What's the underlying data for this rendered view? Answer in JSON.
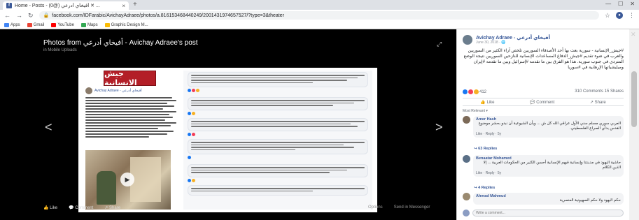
{
  "browser": {
    "tab_title": "Home - Posts - ‎أفيخاي أدرعي (@0) ✕ ...",
    "url": "facebook.com/IDFarabic/AvichayAdraee/photos/a.816153468440249/2001431974657527/?type=3&theater",
    "bookmarks": [
      {
        "label": "Apps",
        "color": "#4285f4"
      },
      {
        "label": "Gmail",
        "color": "#ea4335"
      },
      {
        "label": "YouTube",
        "color": "#ff0000"
      },
      {
        "label": "Maps",
        "color": "#34a853"
      },
      {
        "label": "Graphic Design M...",
        "color": "#fbbc05"
      }
    ]
  },
  "viewer": {
    "title": "Photos from أفيخاي أدرعي - Avichay Adraee's post",
    "subtitle": "in Mobile Uploads",
    "banner_text": "جيش الانسانية",
    "doc_author": "Avichay Adraee - أفيخاي أدرعي",
    "controls": {
      "like": "Like",
      "comment": "Comment",
      "share": "Share",
      "options": "Options",
      "send": "Send in Messenger"
    }
  },
  "side": {
    "author": "Avichay Adraee - أفيخاي أدرعي",
    "date": "June 30, 2018 · 🌐",
    "post_text": "#جيش_الإنسانية - سورية بعث بها أحد الأصدقاء السوريين تلخص آراء الكثير من السوريين والعرب في ضوء تقديم #جيش_الدفاع المساعدات الإنسانية للنازحين السوريين نتيجة الوضع المتردي في جنوب سورية. هذا هو الفرق بين ما تقدمه #إسرائيل وبين ما تقدمه #إيران وميليشياتها الإرهابية في #سوريا",
    "reactions_count": "412",
    "comments_shares": "310 Comments  15 Shares",
    "actions": {
      "like": "Like",
      "comment": "Comment",
      "share": "Share"
    },
    "most_relevant": "Most Relevant ▾",
    "comments": [
      {
        "name": "Amer Hash",
        "text": "العربي سوري مسلم سني الأول عراقي الله كل ش ... ويأن الشيوعية أن نبدو بحشر موضوع القدس بدأي الصراع الفلسطيني.",
        "links": "Like · Reply · 5y",
        "replies": "↪ 63 Replies"
      },
      {
        "name": "Benaatar Mohamed",
        "text": "حاشية اليهود في مدينتنا وإنسانية قيهم الإنسانية أحسن الكثير من الحكومات العربية ... إلا الذين الكلام",
        "links": "Like · Reply · 5y",
        "replies": "↪ 4 Replies"
      },
      {
        "name": "Ahmad Mahmud",
        "text": "حكم اليهود ولا حكم الصهيونية العنصرية",
        "links": "",
        "replies": ""
      }
    ],
    "write_placeholder": "Write a comment..."
  },
  "colors": {
    "fb_blue": "#385898",
    "banner_red": "#b31e27",
    "like_blue": "#1877f2",
    "love_red": "#f33e58",
    "haha_yellow": "#f7b125"
  }
}
